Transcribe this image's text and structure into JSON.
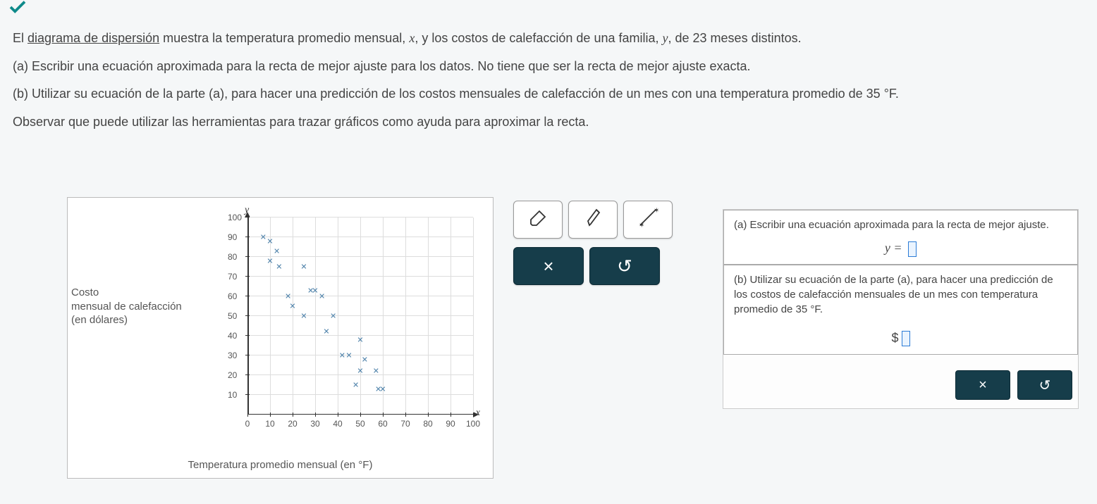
{
  "problem": {
    "intro_prefix": "El ",
    "intro_link": "diagrama de dispersión",
    "intro_suffix": " muestra la temperatura promedio mensual, ",
    "var_x": "x",
    "intro_mid": ", y los costos de calefacción de una familia, ",
    "var_y": "y",
    "intro_end": ", de 23 meses distintos.",
    "part_a": "(a) Escribir una ecuación aproximada para la recta de mejor ajuste para los datos. No tiene que ser la recta de mejor ajuste exacta.",
    "part_b": "(b) Utilizar su ecuación de la parte (a), para hacer una predicción de los costos mensuales de calefacción de un mes con una temperatura promedio de 35 °F.",
    "note": "Observar que puede utilizar las herramientas para trazar gráficos como ayuda para aproximar la recta."
  },
  "chart_data": {
    "type": "scatter",
    "title": "",
    "xlabel": "Temperatura promedio mensual (en °F)",
    "ylabel_lines": [
      "Costo",
      "mensual de calefacción",
      "(en dólares)"
    ],
    "x_axis_letter": "x",
    "y_axis_letter": "y",
    "xlim": [
      0,
      100
    ],
    "ylim": [
      0,
      100
    ],
    "x_ticks": [
      0,
      10,
      20,
      30,
      40,
      50,
      60,
      70,
      80,
      90,
      100
    ],
    "y_ticks": [
      10,
      20,
      30,
      40,
      50,
      60,
      70,
      80,
      90,
      100
    ],
    "points": [
      {
        "x": 7,
        "y": 90
      },
      {
        "x": 10,
        "y": 88
      },
      {
        "x": 13,
        "y": 83
      },
      {
        "x": 10,
        "y": 78
      },
      {
        "x": 14,
        "y": 75
      },
      {
        "x": 25,
        "y": 75
      },
      {
        "x": 28,
        "y": 63
      },
      {
        "x": 30,
        "y": 63
      },
      {
        "x": 18,
        "y": 60
      },
      {
        "x": 20,
        "y": 55
      },
      {
        "x": 33,
        "y": 60
      },
      {
        "x": 25,
        "y": 50
      },
      {
        "x": 38,
        "y": 50
      },
      {
        "x": 35,
        "y": 42
      },
      {
        "x": 50,
        "y": 38
      },
      {
        "x": 42,
        "y": 30
      },
      {
        "x": 45,
        "y": 30
      },
      {
        "x": 52,
        "y": 28
      },
      {
        "x": 50,
        "y": 22
      },
      {
        "x": 57,
        "y": 22
      },
      {
        "x": 48,
        "y": 15
      },
      {
        "x": 58,
        "y": 13
      },
      {
        "x": 60,
        "y": 13
      }
    ]
  },
  "tools": {
    "eraser": "eraser-icon",
    "pencil": "pencil-icon",
    "line": "line-icon",
    "clear": "×",
    "reset": "↺"
  },
  "answers": {
    "a_text": "(a) Escribir una ecuación aproximada para la recta de mejor ajuste.",
    "a_eq_prefix": "y = ",
    "b_text": "(b) Utilizar su ecuación de la parte (a), para hacer una predicción de los costos de calefacción mensuales de un mes con temperatura promedio de 35 °F.",
    "b_prefix": "$"
  },
  "actions": {
    "cancel": "×",
    "redo": "↺"
  }
}
